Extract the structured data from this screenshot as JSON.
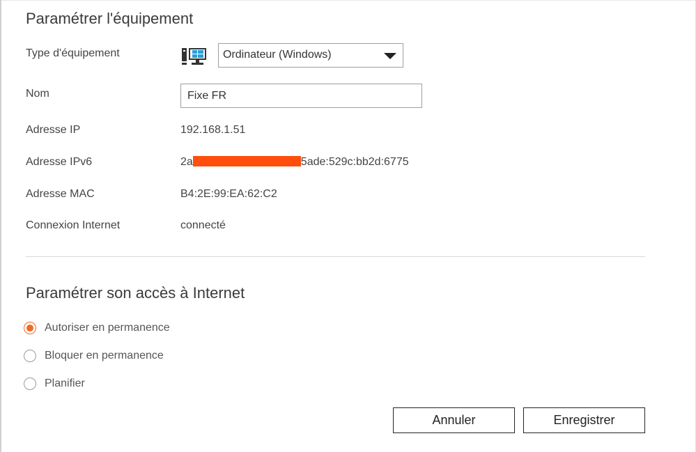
{
  "section_device": {
    "title": "Paramétrer l'équipement",
    "device_type": {
      "label": "Type d'équipement",
      "icon": "windows-computer-icon",
      "selected": "Ordinateur (Windows)"
    },
    "name": {
      "label": "Nom",
      "value": "Fixe FR"
    },
    "ip": {
      "label": "Adresse IP",
      "value": "192.168.1.51"
    },
    "ipv6": {
      "label": "Adresse IPv6",
      "prefix": "2a",
      "suffix": "5ade:529c:bb2d:6775",
      "redaction_color": "#ff4e0d"
    },
    "mac": {
      "label": "Adresse MAC",
      "value": "B4:2E:99:EA:62:C2"
    },
    "connection": {
      "label": "Connexion Internet",
      "value": "connecté"
    }
  },
  "section_access": {
    "title": "Paramétrer son accès à Internet",
    "options": [
      {
        "label": "Autoriser en permanence",
        "checked": true
      },
      {
        "label": "Bloquer en permanence",
        "checked": false
      },
      {
        "label": "Planifier",
        "checked": false
      }
    ]
  },
  "actions": {
    "cancel": "Annuler",
    "save": "Enregistrer"
  },
  "colors": {
    "accent": "#f06b22",
    "text": "#444444"
  }
}
